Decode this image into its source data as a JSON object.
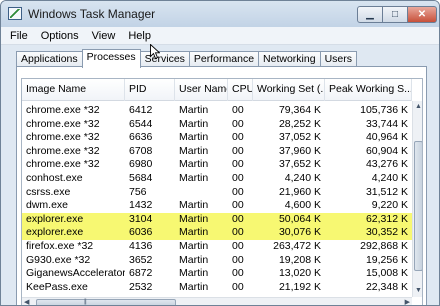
{
  "window": {
    "title": "Windows Task Manager",
    "minimize_glyph": "▁",
    "maximize_glyph": "□",
    "close_glyph": "✕"
  },
  "menu": [
    "File",
    "Options",
    "View",
    "Help"
  ],
  "tabs": [
    "Applications",
    "Processes",
    "Services",
    "Performance",
    "Networking",
    "Users"
  ],
  "active_tab": "Processes",
  "columns": [
    "Image Name",
    "PID",
    "User Name",
    "CPU",
    "Working Set (...",
    "Peak Working S..."
  ],
  "processes": [
    {
      "name": "chrome.exe *32",
      "pid": "6412",
      "user": "Martin",
      "cpu": "00",
      "ws": "79,364 K",
      "peak": "105,736 K",
      "highlight": false
    },
    {
      "name": "chrome.exe *32",
      "pid": "6544",
      "user": "Martin",
      "cpu": "00",
      "ws": "28,252 K",
      "peak": "33,744 K",
      "highlight": false
    },
    {
      "name": "chrome.exe *32",
      "pid": "6636",
      "user": "Martin",
      "cpu": "00",
      "ws": "37,052 K",
      "peak": "40,964 K",
      "highlight": false
    },
    {
      "name": "chrome.exe *32",
      "pid": "6708",
      "user": "Martin",
      "cpu": "00",
      "ws": "37,960 K",
      "peak": "60,904 K",
      "highlight": false
    },
    {
      "name": "chrome.exe *32",
      "pid": "6980",
      "user": "Martin",
      "cpu": "00",
      "ws": "37,652 K",
      "peak": "43,276 K",
      "highlight": false
    },
    {
      "name": "conhost.exe",
      "pid": "5684",
      "user": "Martin",
      "cpu": "00",
      "ws": "4,240 K",
      "peak": "4,240 K",
      "highlight": false
    },
    {
      "name": "csrss.exe",
      "pid": "756",
      "user": "",
      "cpu": "00",
      "ws": "21,960 K",
      "peak": "31,512 K",
      "highlight": false
    },
    {
      "name": "dwm.exe",
      "pid": "1432",
      "user": "Martin",
      "cpu": "00",
      "ws": "4,600 K",
      "peak": "9,220 K",
      "highlight": false
    },
    {
      "name": "explorer.exe",
      "pid": "3104",
      "user": "Martin",
      "cpu": "00",
      "ws": "50,064 K",
      "peak": "62,312 K",
      "highlight": true
    },
    {
      "name": "explorer.exe",
      "pid": "6036",
      "user": "Martin",
      "cpu": "00",
      "ws": "30,076 K",
      "peak": "30,352 K",
      "highlight": true
    },
    {
      "name": "firefox.exe *32",
      "pid": "4136",
      "user": "Martin",
      "cpu": "00",
      "ws": "263,472 K",
      "peak": "292,868 K",
      "highlight": false
    },
    {
      "name": "G930.exe *32",
      "pid": "3652",
      "user": "Martin",
      "cpu": "00",
      "ws": "19,208 K",
      "peak": "19,256 K",
      "highlight": false
    },
    {
      "name": "GiganewsAccelerator...",
      "pid": "6872",
      "user": "Martin",
      "cpu": "00",
      "ws": "13,020 K",
      "peak": "15,008 K",
      "highlight": false
    },
    {
      "name": "KeePass.exe",
      "pid": "2532",
      "user": "Martin",
      "cpu": "00",
      "ws": "21,192 K",
      "peak": "22,348 K",
      "highlight": false
    }
  ],
  "colors": {
    "highlight": "#f7f872",
    "titlebar": "#c2d3e6"
  }
}
